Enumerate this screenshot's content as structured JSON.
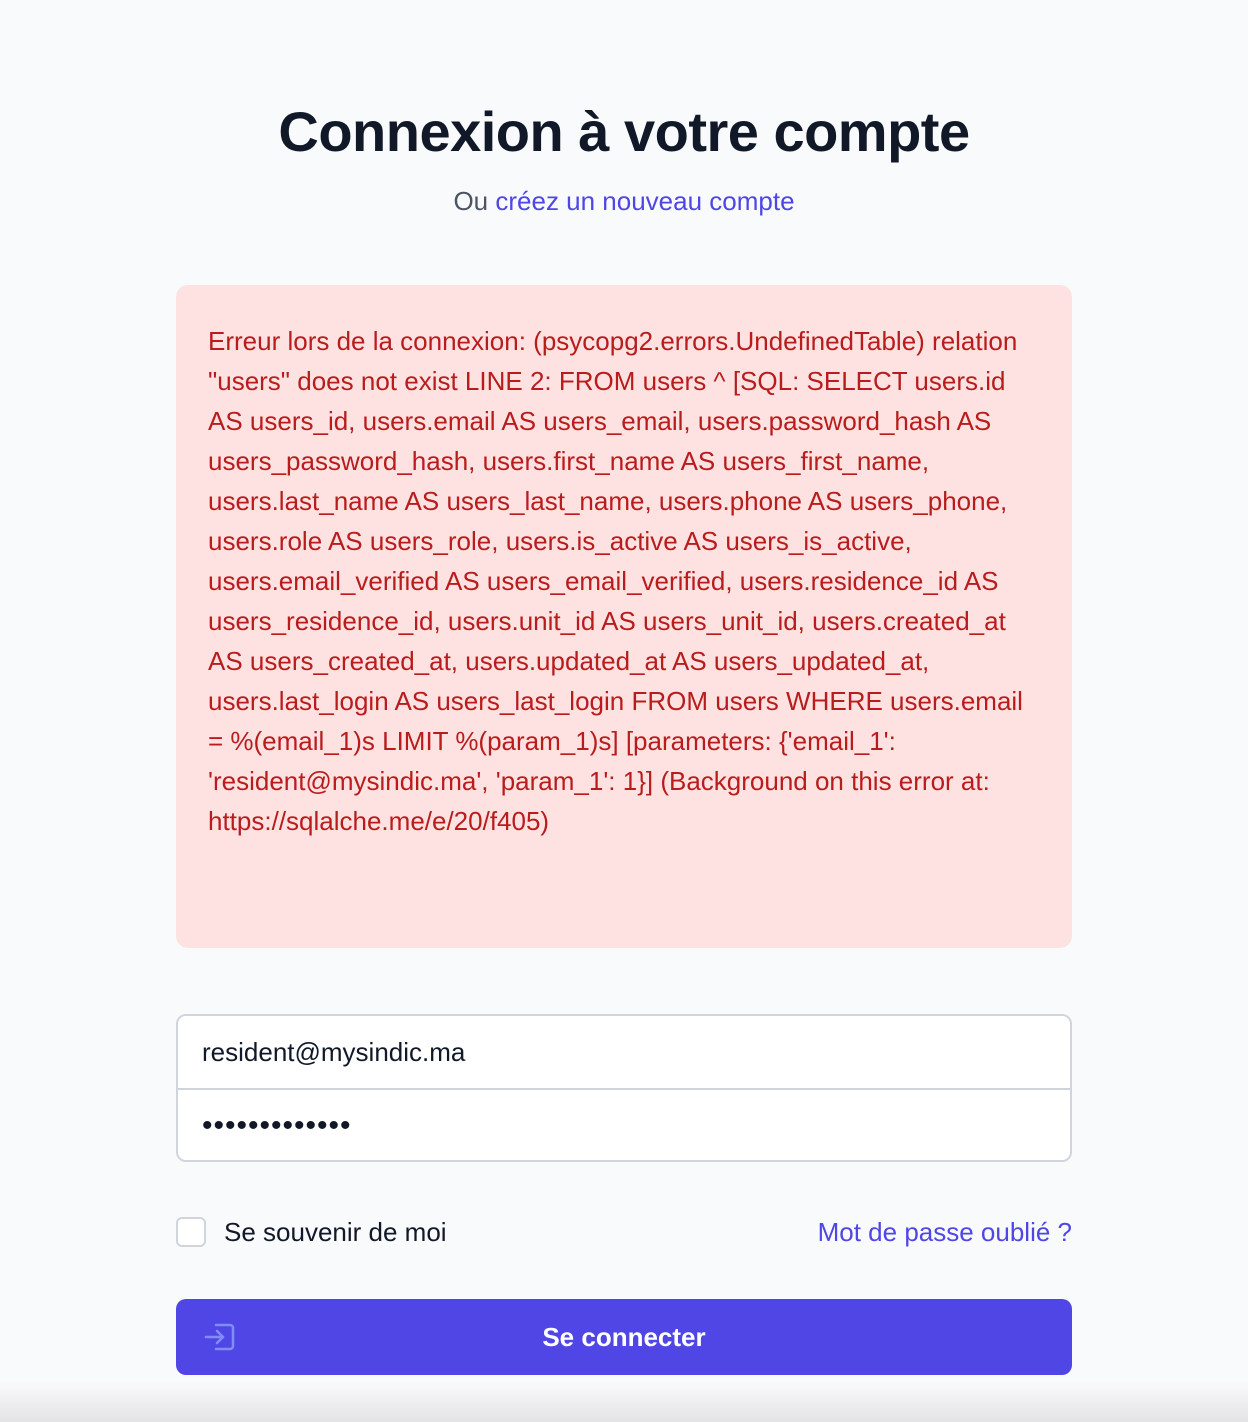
{
  "header": {
    "title": "Connexion à votre compte",
    "subtitle_prefix": "Ou ",
    "subtitle_link": "créez un nouveau compte"
  },
  "error": {
    "message": "Erreur lors de la connexion: (psycopg2.errors.UndefinedTable) relation \"users\" does not exist LINE 2: FROM users ^ [SQL: SELECT users.id AS users_id, users.email AS users_email, users.password_hash AS users_password_hash, users.first_name AS users_first_name, users.last_name AS users_last_name, users.phone AS users_phone, users.role AS users_role, users.is_active AS users_is_active, users.email_verified AS users_email_verified, users.residence_id AS users_residence_id, users.unit_id AS users_unit_id, users.created_at AS users_created_at, users.updated_at AS users_updated_at, users.last_login AS users_last_login FROM users WHERE users.email = %(email_1)s LIMIT %(param_1)s] [parameters: {'email_1': 'resident@mysindic.ma', 'param_1': 1}] (Background on this error at: https://sqlalche.me/e/20/f405)"
  },
  "form": {
    "email_value": "resident@mysindic.ma",
    "password_value": "•••••••••••••",
    "remember_label": "Se souvenir de moi",
    "remember_checked": false,
    "forgot_label": "Mot de passe oublié ?",
    "submit_label": "Se connecter",
    "submit_icon": "login-icon"
  },
  "colors": {
    "accent": "#4f46e5",
    "error_bg": "#fee2e2",
    "error_text": "#b91c1c",
    "title": "#111827",
    "background": "#f9fafb"
  }
}
